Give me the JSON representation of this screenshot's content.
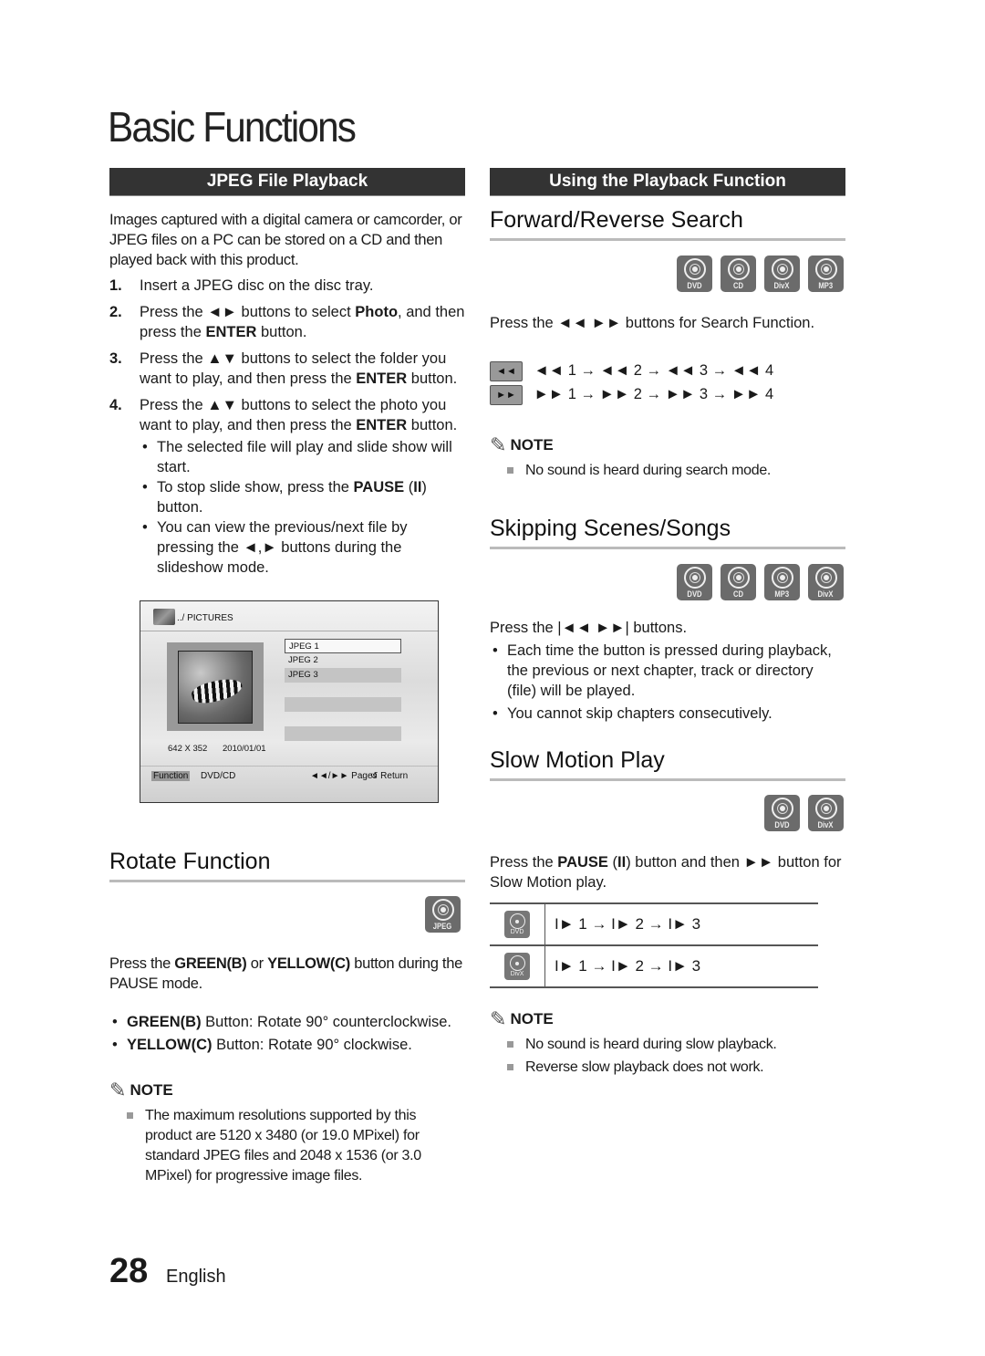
{
  "page": {
    "title": "Basic Functions",
    "number": "28",
    "language": "English"
  },
  "left": {
    "bar": "JPEG File Playback",
    "intro": "Images captured with a digital camera or camcorder, or JPEG files on a PC can be stored on a CD and then played back with this product.",
    "steps": [
      {
        "num": "1.",
        "text": "Insert a JPEG disc on the disc tray."
      },
      {
        "num": "2.",
        "pre": "Press the ◄► buttons to select ",
        "b1": "Photo",
        "mid": ", and then press the ",
        "b2": "ENTER",
        "post": " button."
      },
      {
        "num": "3.",
        "pre": "Press the ▲▼ buttons to select the folder you want to play, and then press the ",
        "b1": "ENTER",
        "post": " button."
      },
      {
        "num": "4.",
        "pre": "Press the ▲▼ buttons to select the photo you want to play, and then press the ",
        "b1": "ENTER",
        "post": " button."
      }
    ],
    "step4_bullets": [
      {
        "text": "The selected file will play and slide show will start."
      },
      {
        "pre": "To stop slide show, press the ",
        "b1": "PAUSE",
        "mid": " (",
        "b2": "II",
        "post": ") button."
      },
      {
        "text": "You can view the previous/next file by pressing the ◄,► buttons during the slideshow mode."
      }
    ],
    "screen": {
      "path": "../ PICTURES",
      "files": [
        "JPEG 1",
        "JPEG 2",
        "JPEG 3"
      ],
      "resolution": "642 X 352",
      "date": "2010/01/01",
      "function_label": "Function",
      "source": "DVD/CD",
      "pages": "◄◄/►► Pages",
      "return": "↺ Return"
    },
    "rotate": {
      "title": "Rotate Function",
      "disc": "JPEG",
      "instr_pre": "Press the ",
      "instr_b1": "GREEN(B)",
      "instr_mid": " or ",
      "instr_b2": "YELLOW(C)",
      "instr_post": " button during the PAUSE mode.",
      "bullets": [
        {
          "b": "GREEN(B)",
          "text": " Button: Rotate 90° counterclockwise."
        },
        {
          "b": "YELLOW(C)",
          "text": " Button: Rotate 90° clockwise."
        }
      ],
      "note_label": "NOTE",
      "notes": [
        "The maximum resolutions supported by this product are 5120 x 3480 (or 19.0 MPixel) for standard JPEG files and 2048 x 1536 (or 3.0 MPixel) for progressive image files."
      ]
    }
  },
  "right": {
    "bar": "Using the Playback Function",
    "search": {
      "title": "Forward/Reverse Search",
      "discs": [
        "DVD",
        "CD",
        "DivX",
        "MP3"
      ],
      "instr": "Press the ◄◄ ►► buttons for Search Function.",
      "rev_key": "◄◄",
      "fwd_key": "►►",
      "rev_seq": "◄◄ 1 → ◄◄ 2 → ◄◄ 3 → ◄◄ 4",
      "fwd_seq": "►► 1 → ►► 2 → ►► 3 → ►► 4",
      "note_label": "NOTE",
      "notes": [
        "No sound is heard during search mode."
      ]
    },
    "skip": {
      "title": "Skipping Scenes/Songs",
      "discs": [
        "DVD",
        "CD",
        "MP3",
        "DivX"
      ],
      "instr": "Press the |◄◄ ►►| buttons.",
      "bullets": [
        "Each time the button is pressed during playback, the previous or next chapter, track or directory (file) will be played.",
        "You cannot skip chapters consecutively."
      ]
    },
    "slow": {
      "title": "Slow Motion Play",
      "discs": [
        "DVD",
        "DivX"
      ],
      "instr_pre": "Press the ",
      "instr_b1": "PAUSE",
      "instr_mid": " (",
      "instr_b2": "II",
      "instr_post": ") button and then ►► button for Slow Motion play.",
      "rows": [
        {
          "disc": "DVD",
          "seq": "I► 1 → I► 2 → I► 3"
        },
        {
          "disc": "DivX",
          "seq": "I► 1 → I► 2 → I► 3"
        }
      ],
      "note_label": "NOTE",
      "notes": [
        "No sound is heard during slow playback.",
        "Reverse slow playback does not work."
      ]
    }
  }
}
